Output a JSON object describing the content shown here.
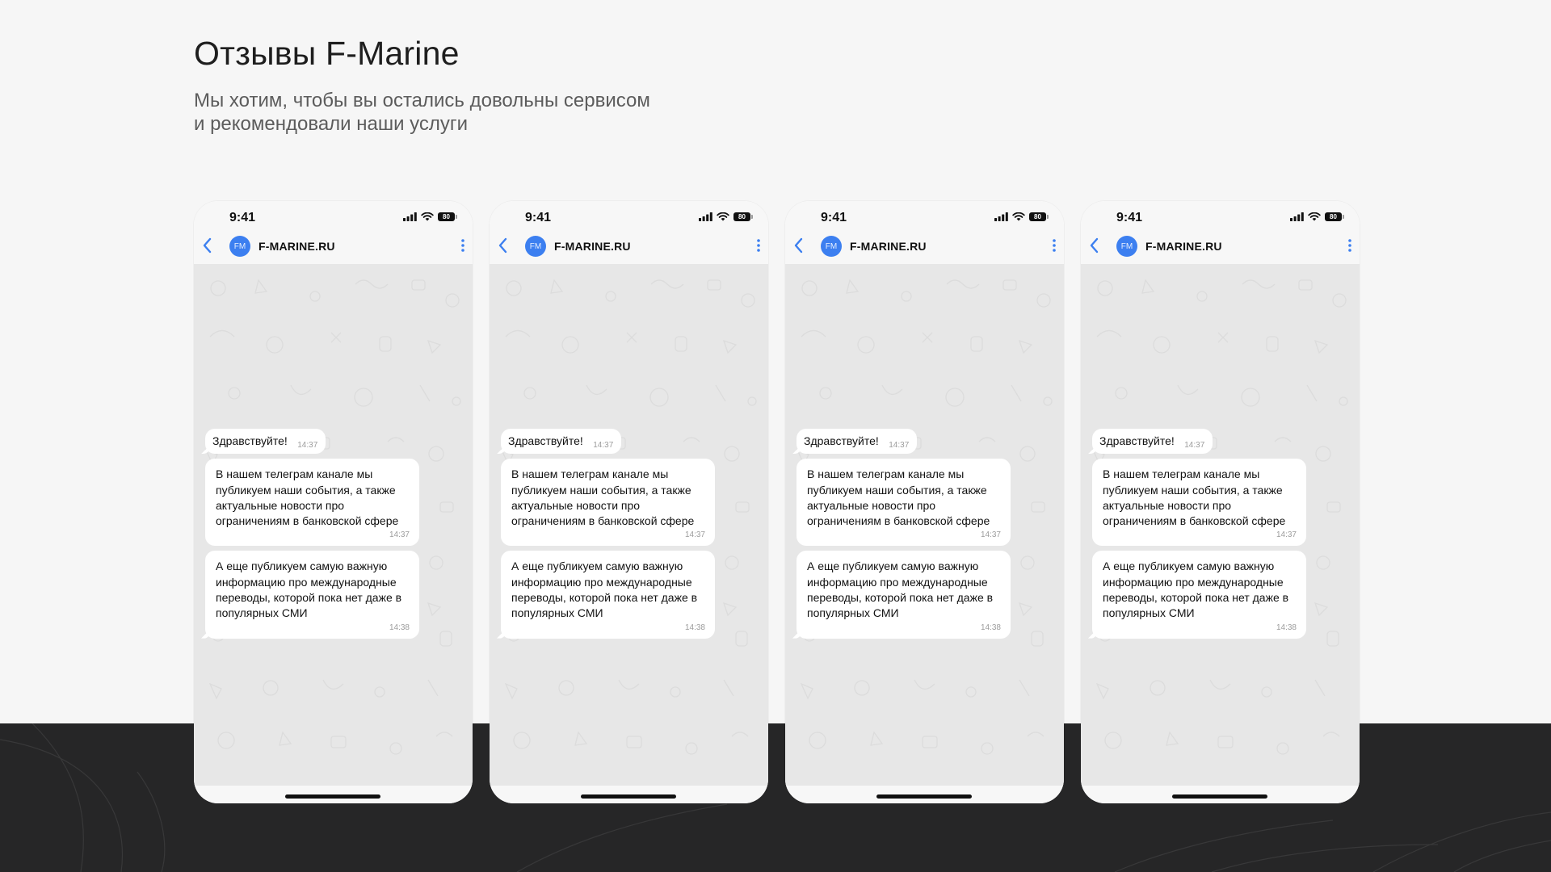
{
  "page": {
    "title": "Отзывы F-Marine",
    "subtitle_lines": [
      "Мы хотим, чтобы вы остались довольны сервисом",
      "и рекомендовали наши услуги"
    ]
  },
  "colors": {
    "background": "#f6f6f6",
    "dark_band": "#262627",
    "accent": "#3c7ff0",
    "chat_background": "#e7e7e7"
  },
  "phones": [
    {
      "status": {
        "time": "9:41",
        "battery": "80"
      },
      "chat": {
        "avatar_initials": "FM",
        "name": "F-MARINE.RU"
      },
      "messages": [
        {
          "text": "Здравствуйте!",
          "time": "14:37"
        },
        {
          "text": "В нашем телеграм канале мы публикуем наши события, а также актуальные новости про ограничениям в банковской сфере",
          "time": "14:37"
        },
        {
          "text": "А еще публикуем самую важную информацию про международные переводы, которой пока нет даже в популярных СМИ",
          "time": "14:38"
        }
      ]
    },
    {
      "status": {
        "time": "9:41",
        "battery": "80"
      },
      "chat": {
        "avatar_initials": "FM",
        "name": "F-MARINE.RU"
      },
      "messages": [
        {
          "text": "Здравствуйте!",
          "time": "14:37"
        },
        {
          "text": "В нашем телеграм канале мы публикуем наши события, а также актуальные новости про ограничениям в банковской сфере",
          "time": "14:37"
        },
        {
          "text": "А еще публикуем самую важную информацию про международные переводы, которой пока нет даже в популярных СМИ",
          "time": "14:38"
        }
      ]
    },
    {
      "status": {
        "time": "9:41",
        "battery": "80"
      },
      "chat": {
        "avatar_initials": "FM",
        "name": "F-MARINE.RU"
      },
      "messages": [
        {
          "text": "Здравствуйте!",
          "time": "14:37"
        },
        {
          "text": "В нашем телеграм канале мы публикуем наши события, а также актуальные новости про ограничениям в банковской сфере",
          "time": "14:37"
        },
        {
          "text": "А еще публикуем самую важную информацию про международные переводы, которой пока нет даже в популярных СМИ",
          "time": "14:38"
        }
      ]
    },
    {
      "status": {
        "time": "9:41",
        "battery": "80"
      },
      "chat": {
        "avatar_initials": "FM",
        "name": "F-MARINE.RU"
      },
      "messages": [
        {
          "text": "Здравствуйте!",
          "time": "14:37"
        },
        {
          "text": "В нашем телеграм канале мы публикуем наши события, а также актуальные новости про ограничениям в банковской сфере",
          "time": "14:37"
        },
        {
          "text": "А еще публикуем самую важную информацию про международные переводы, которой пока нет даже в популярных СМИ",
          "time": "14:38"
        }
      ]
    }
  ],
  "icons": {
    "back": "chevron-left-icon",
    "menu": "more-vertical-icon",
    "signal": "cellular-signal-icon",
    "wifi": "wifi-icon",
    "battery": "battery-icon"
  }
}
